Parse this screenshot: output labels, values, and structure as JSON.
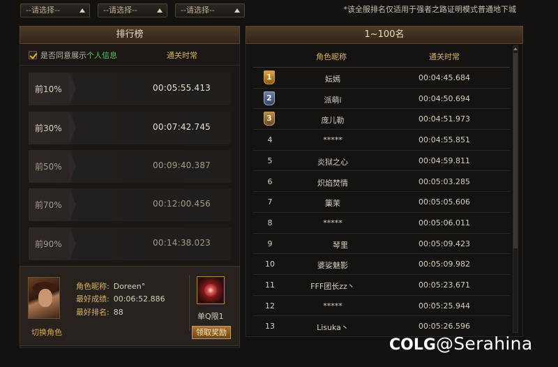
{
  "filters": [
    {
      "label": "--请选择--"
    },
    {
      "label": "--请选择--"
    },
    {
      "label": "--请选择--"
    }
  ],
  "notice": "*该全服排名仅适用于强者之路证明模式普通地下城",
  "left_panel": {
    "title": "排行榜",
    "agree_prefix": "是否同意展示",
    "agree_highlight": "个人信息",
    "column_header": "通关时常",
    "tiers": [
      {
        "name": "前10%",
        "time": "00:05:55.413"
      },
      {
        "name": "前30%",
        "time": "00:07:42.745"
      },
      {
        "name": "前50%",
        "time": "00:09:40.387"
      },
      {
        "name": "前70%",
        "time": "00:12:00.456"
      },
      {
        "name": "前90%",
        "time": "00:14:38.023"
      }
    ]
  },
  "profile": {
    "switch_role": "切换角色",
    "name_label": "角色昵称:",
    "name_value": "Doreen°",
    "best_label": "最好成绩:",
    "best_value": "00:06:52.886",
    "rank_label": "最好排名:",
    "rank_value": "88",
    "reward_label": "单Q限1",
    "reward_button": "领取奖励"
  },
  "right_panel": {
    "title": "1~100名",
    "col_name": "角色昵称",
    "col_time": "通关时常",
    "rows": [
      {
        "rank": "1",
        "name": "妘嫣",
        "time": "00:04:45.684"
      },
      {
        "rank": "2",
        "name": "派萌i",
        "time": "00:04:50.694"
      },
      {
        "rank": "3",
        "name": "庞儿勒",
        "time": "00:04:51.973"
      },
      {
        "rank": "4",
        "name": "*****",
        "time": "00:04:55.851"
      },
      {
        "rank": "5",
        "name": "炎狱之心",
        "time": "00:04:59.811"
      },
      {
        "rank": "6",
        "name": "炽焰焚情",
        "time": "00:05:03.285"
      },
      {
        "rank": "7",
        "name": "篥茉",
        "time": "00:05:05.606"
      },
      {
        "rank": "8",
        "name": "*****",
        "time": "00:05:06.011"
      },
      {
        "rank": "9",
        "name": "　　琴里",
        "time": "00:05:09.423"
      },
      {
        "rank": "10",
        "name": "婆娑魅影",
        "time": "00:05:09.982"
      },
      {
        "rank": "11",
        "name": "FFF团长zz丶",
        "time": "00:05:23.671"
      },
      {
        "rank": "12",
        "name": "*****",
        "time": "00:05:25.944"
      },
      {
        "rank": "13",
        "name": "Lisuka丶",
        "time": "00:05:26.596"
      }
    ]
  },
  "watermark": {
    "logo": "COLG",
    "text": "@Serahina"
  }
}
